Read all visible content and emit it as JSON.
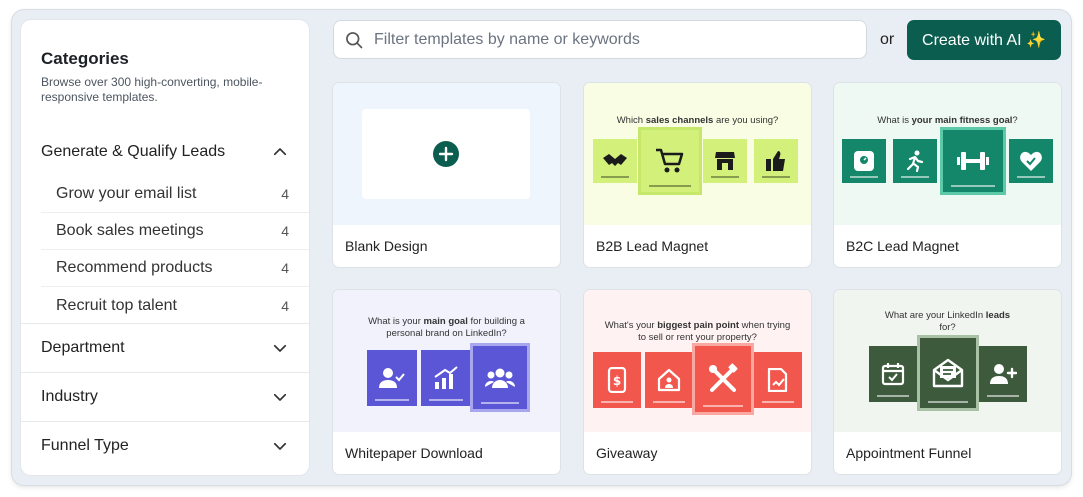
{
  "sidebar": {
    "title": "Categories",
    "subtitle": "Browse over 300 high-converting, mobile-responsive templates.",
    "groups": [
      {
        "label": "Generate & Qualify Leads",
        "expanded": true,
        "items": [
          {
            "label": "Grow your email list",
            "count": "4"
          },
          {
            "label": "Book sales meetings",
            "count": "4"
          },
          {
            "label": "Recommend products",
            "count": "4"
          },
          {
            "label": "Recruit top talent",
            "count": "4"
          }
        ]
      },
      {
        "label": "Department",
        "expanded": false
      },
      {
        "label": "Industry",
        "expanded": false
      },
      {
        "label": "Funnel Type",
        "expanded": false
      }
    ]
  },
  "toolbar": {
    "search_placeholder": "Filter templates by name or keywords",
    "search_value": "",
    "or_label": "or",
    "ai_button_label": "Create with AI ✨"
  },
  "templates": [
    {
      "name": "Blank Design",
      "icon": "plus-circle-icon"
    },
    {
      "name": "B2B Lead Magnet",
      "question_pre": "Which ",
      "question_bold": "sales channels",
      "question_post": " are you using?"
    },
    {
      "name": "B2C Lead Magnet",
      "question_pre": "What is ",
      "question_bold": "your main fitness goal",
      "question_post": "?"
    },
    {
      "name": "Whitepaper Download",
      "question_pre": "What is your ",
      "question_bold": "main goal",
      "question_post": " for building a personal brand on LinkedIn?"
    },
    {
      "name": "Giveaway",
      "question_pre": "What's your ",
      "question_bold": "biggest pain point",
      "question_post": " when trying to sell or rent your property?"
    },
    {
      "name": "Appointment Funnel",
      "question_pre": "What are your LinkedIn ",
      "question_bold": "leads",
      "question_post": " for?"
    }
  ],
  "colors": {
    "brand": "#0b5e4f",
    "b2b_tile": "#d2f07a",
    "b2c_tile": "#14876a",
    "whitepaper_tile": "#5a56d6",
    "giveaway_tile": "#f2574e",
    "appointment_tile": "#3d5a3c"
  }
}
